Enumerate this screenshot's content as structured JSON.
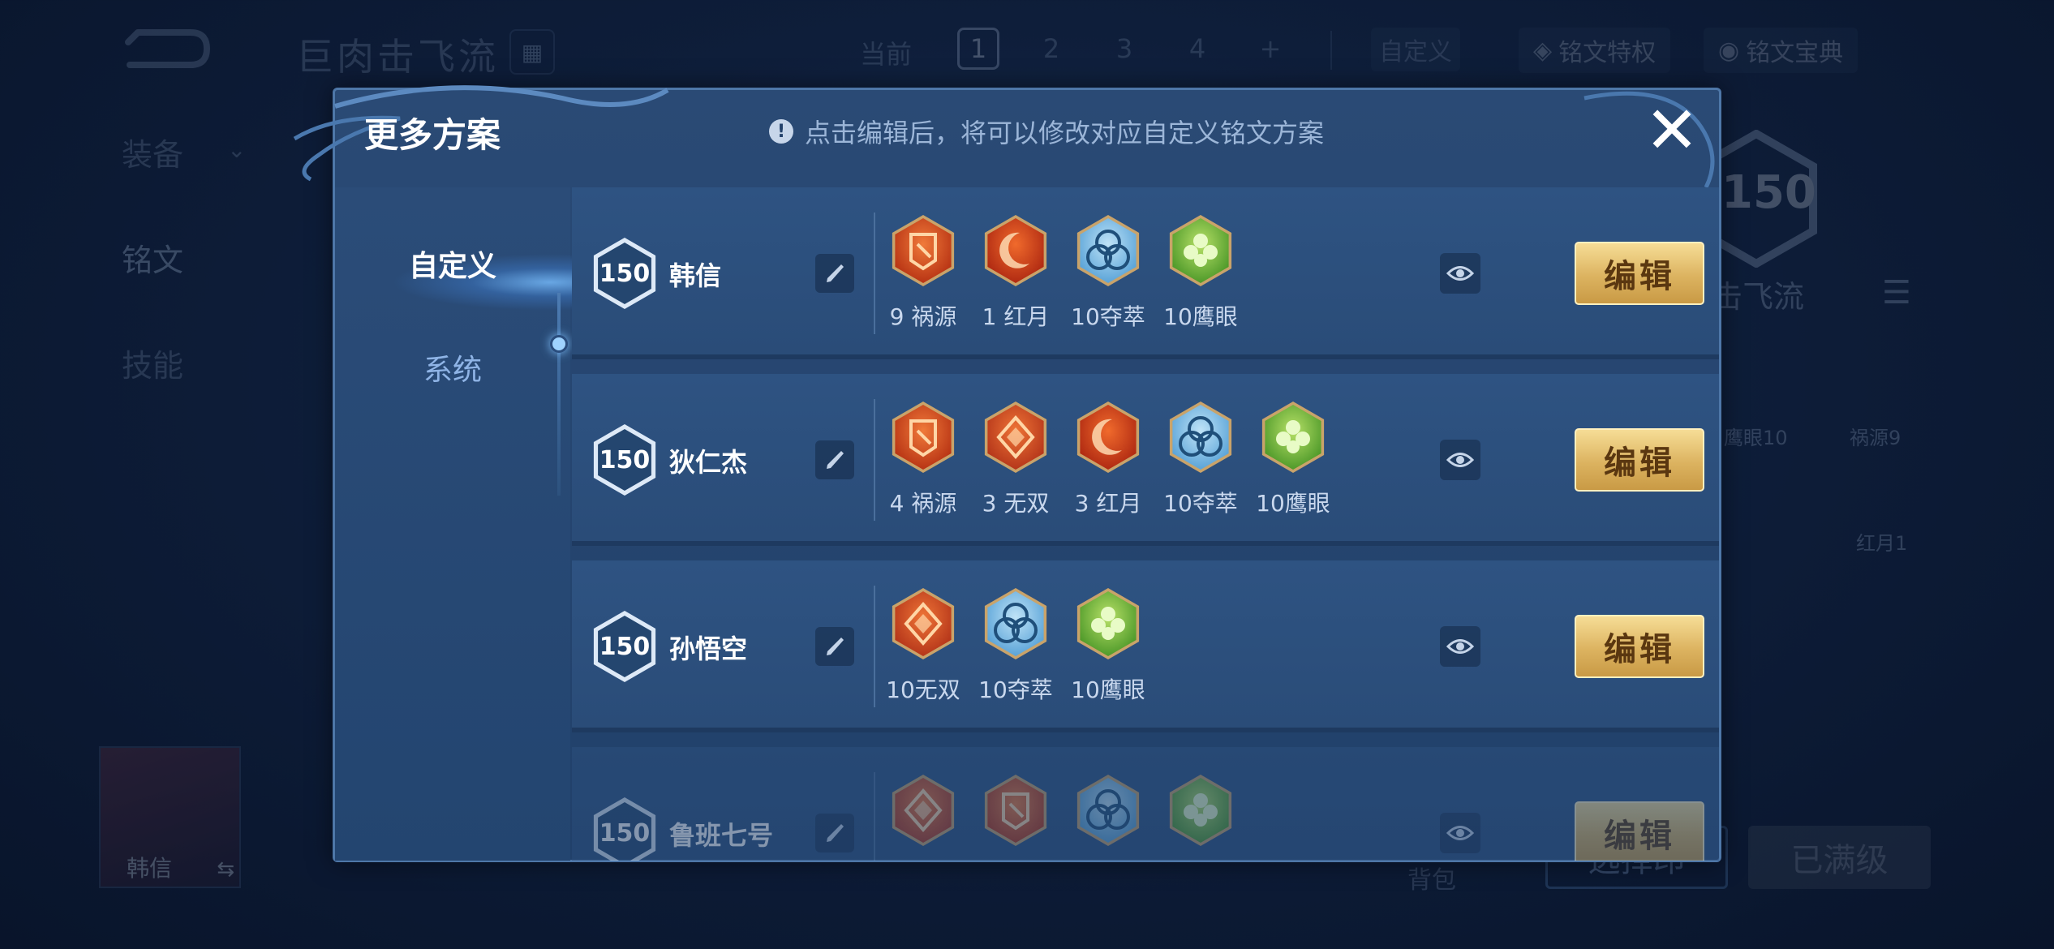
{
  "background": {
    "title": "巨肉击飞流",
    "current_label": "当前",
    "pages": [
      "1",
      "2",
      "3",
      "4",
      "+"
    ],
    "custom_label": "自定义",
    "privilege_label": "铭文特权",
    "collection_label": "铭文宝典",
    "nav": [
      "装备",
      "铭文",
      "技能"
    ],
    "hero_name": "韩信",
    "bag_label": "背包",
    "select_label": "选择印",
    "maxed_label": "已满级",
    "right_level": "150",
    "right_name": "击飞流",
    "right_runes": [
      {
        "label": "鹰眼10",
        "icon": "heart-rune-icon"
      },
      {
        "label": "祸源9",
        "icon": "shield-rune-icon"
      },
      {
        "label": "红月1",
        "icon": "moon-rune-icon"
      }
    ]
  },
  "modal": {
    "title": "更多方案",
    "hint": "点击编辑后，将可以修改对应自定义铭文方案",
    "hint_icon": "!",
    "close": "✕",
    "tabs": [
      "自定义",
      "系统"
    ],
    "edit_label": "编辑",
    "rows": [
      {
        "level": "150",
        "hero": "韩信",
        "runes": [
          {
            "label": "9 祸源",
            "type": "red-shield"
          },
          {
            "label": "1 红月",
            "type": "red-moon"
          },
          {
            "label": "10夺萃",
            "type": "blue-knot"
          },
          {
            "label": "10鹰眼",
            "type": "green-clover"
          }
        ]
      },
      {
        "level": "150",
        "hero": "狄仁杰",
        "runes": [
          {
            "label": "4 祸源",
            "type": "red-shield"
          },
          {
            "label": "3 无双",
            "type": "red-diamond"
          },
          {
            "label": "3 红月",
            "type": "red-moon"
          },
          {
            "label": "10夺萃",
            "type": "blue-knot"
          },
          {
            "label": "10鹰眼",
            "type": "green-clover"
          }
        ]
      },
      {
        "level": "150",
        "hero": "孙悟空",
        "runes": [
          {
            "label": "10无双",
            "type": "red-diamond"
          },
          {
            "label": "10夺萃",
            "type": "blue-knot"
          },
          {
            "label": "10鹰眼",
            "type": "green-clover"
          }
        ]
      },
      {
        "level": "150",
        "hero": "鲁班七号",
        "runes": [
          {
            "label": "",
            "type": "red-diamond"
          },
          {
            "label": "",
            "type": "red-shield"
          },
          {
            "label": "",
            "type": "blue-knot"
          },
          {
            "label": "",
            "type": "green-clover"
          }
        ]
      }
    ]
  },
  "colors": {
    "red_rune": "#d9531f",
    "blue_rune": "#6fb7e6",
    "green_rune": "#7cc144",
    "gold_button": "#dcb360",
    "modal_bg": "#21406a"
  }
}
